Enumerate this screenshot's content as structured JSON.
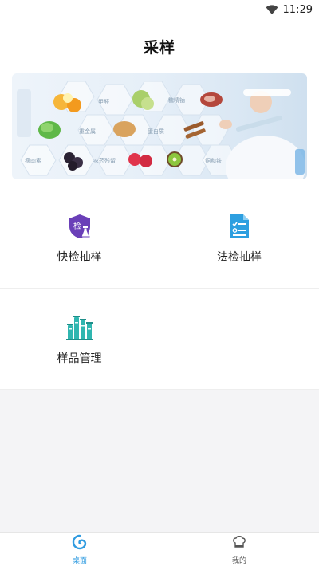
{
  "status_bar": {
    "time": "11:29",
    "wifi_icon": "wifi-icon"
  },
  "header": {
    "title": "采样"
  },
  "banner": {
    "labels": [
      "甲醛",
      "糖精钠",
      "重金属",
      "蛋白质",
      "瘦肉素",
      "农药残留",
      "铜和铁"
    ]
  },
  "menu": {
    "items": [
      {
        "label": "快检抽样",
        "icon": "quick-test-shield-icon"
      },
      {
        "label": "法检抽样",
        "icon": "document-checklist-icon"
      },
      {
        "label": "样品管理",
        "icon": "sample-tubes-icon"
      }
    ]
  },
  "tab_bar": {
    "items": [
      {
        "label": "桌面",
        "icon": "desktop-swirl-icon",
        "active": true
      },
      {
        "label": "我的",
        "icon": "chef-hat-icon",
        "active": false
      }
    ]
  },
  "colors": {
    "accent": "#2f9be0",
    "purple": "#6a3fb8",
    "teal": "#2fb6b0",
    "blue_doc": "#2d9fe0"
  }
}
